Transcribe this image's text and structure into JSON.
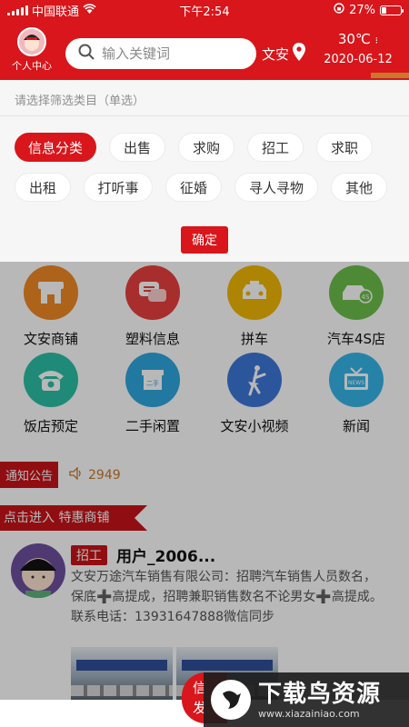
{
  "status_bar": {
    "carrier": "中国联通",
    "time": "下午2:54",
    "battery": "27%",
    "battery_level": 0.27
  },
  "header": {
    "profile_label": "个人中心",
    "search_placeholder": "输入关键词",
    "city": "文安",
    "temperature": "30℃",
    "date": "2020-06-12",
    "accent_color": "#d8161b"
  },
  "filter": {
    "hint": "请选择筛选类目（单选）",
    "row1": [
      "信息分类",
      "出售",
      "求购",
      "招工",
      "求职"
    ],
    "row2": [
      "出租",
      "打听事",
      "征婚",
      "寻人寻物",
      "其他"
    ],
    "selected": "信息分类",
    "confirm_label": "确定"
  },
  "grid": [
    {
      "label": "文安商铺",
      "icon": "shop-icon",
      "color": "#f08a24"
    },
    {
      "label": "塑料信息",
      "icon": "chat-bubble-icon",
      "color": "#e8403e"
    },
    {
      "label": "拼车",
      "icon": "taxi-icon",
      "color": "#f2b705"
    },
    {
      "label": "汽车4S店",
      "icon": "car-4s-icon",
      "color": "#6cc04a"
    },
    {
      "label": "饭店预定",
      "icon": "telephone-icon",
      "color": "#2bc0a5"
    },
    {
      "label": "二手闲置",
      "icon": "secondhand-box-icon",
      "color": "#2ea7e0"
    },
    {
      "label": "文安小视频",
      "icon": "dancer-icon",
      "color": "#3d78d8"
    },
    {
      "label": "新闻",
      "icon": "news-tv-icon",
      "color": "#35b6e8"
    }
  ],
  "notice": {
    "tag": "通知公告",
    "count": "2949"
  },
  "promo": {
    "label": "点击进入 特惠商铺"
  },
  "post": {
    "tag": "招工",
    "user": "用户_2006...",
    "text": "文安万途汽车销售有限公司：招聘汽车销售人员数名，保底➕高提成，招聘兼职销售数名不论男女➕高提成。联系电话：13931647888微信同步"
  },
  "float_button": {
    "line1": "信",
    "line2": "发"
  },
  "watermark": {
    "name": "下载鸟资源",
    "url": "www.xiazainiao.com"
  }
}
